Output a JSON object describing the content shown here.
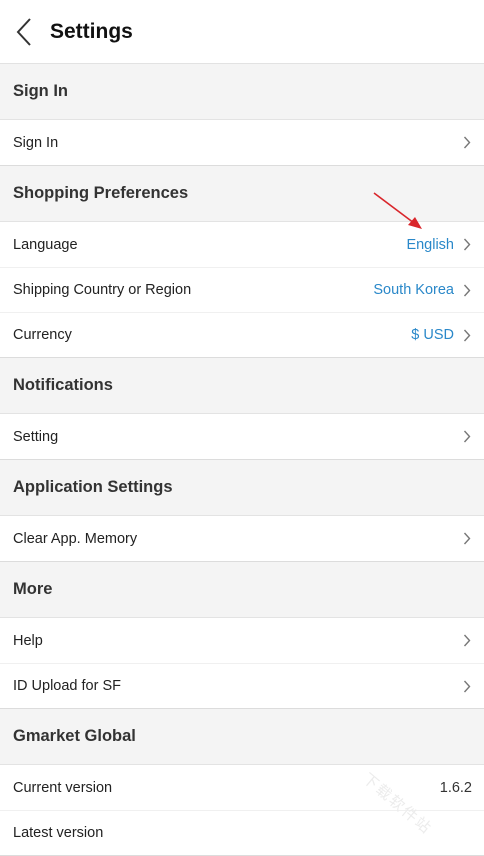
{
  "header": {
    "title": "Settings",
    "back_icon": "chevron-left-icon"
  },
  "sections": {
    "sign_in": {
      "title": "Sign In",
      "items": [
        {
          "label": "Sign In"
        }
      ]
    },
    "shopping": {
      "title": "Shopping Preferences",
      "items": [
        {
          "label": "Language",
          "value": "English"
        },
        {
          "label": "Shipping Country or Region",
          "value": "South Korea"
        },
        {
          "label": "Currency",
          "value": "$ USD"
        }
      ]
    },
    "notifications": {
      "title": "Notifications",
      "items": [
        {
          "label": "Setting"
        }
      ]
    },
    "app_settings": {
      "title": "Application Settings",
      "items": [
        {
          "label": "Clear App. Memory"
        }
      ]
    },
    "more": {
      "title": "More",
      "items": [
        {
          "label": "Help"
        },
        {
          "label": "ID Upload for SF"
        }
      ]
    },
    "global": {
      "title": "Gmarket Global",
      "items": [
        {
          "label": "Current version",
          "value": "1.6.2"
        },
        {
          "label": "Latest version"
        }
      ]
    }
  },
  "colors": {
    "accent": "#2a88c9",
    "annotation_arrow": "#d9262b"
  },
  "watermark": "下载软件站"
}
